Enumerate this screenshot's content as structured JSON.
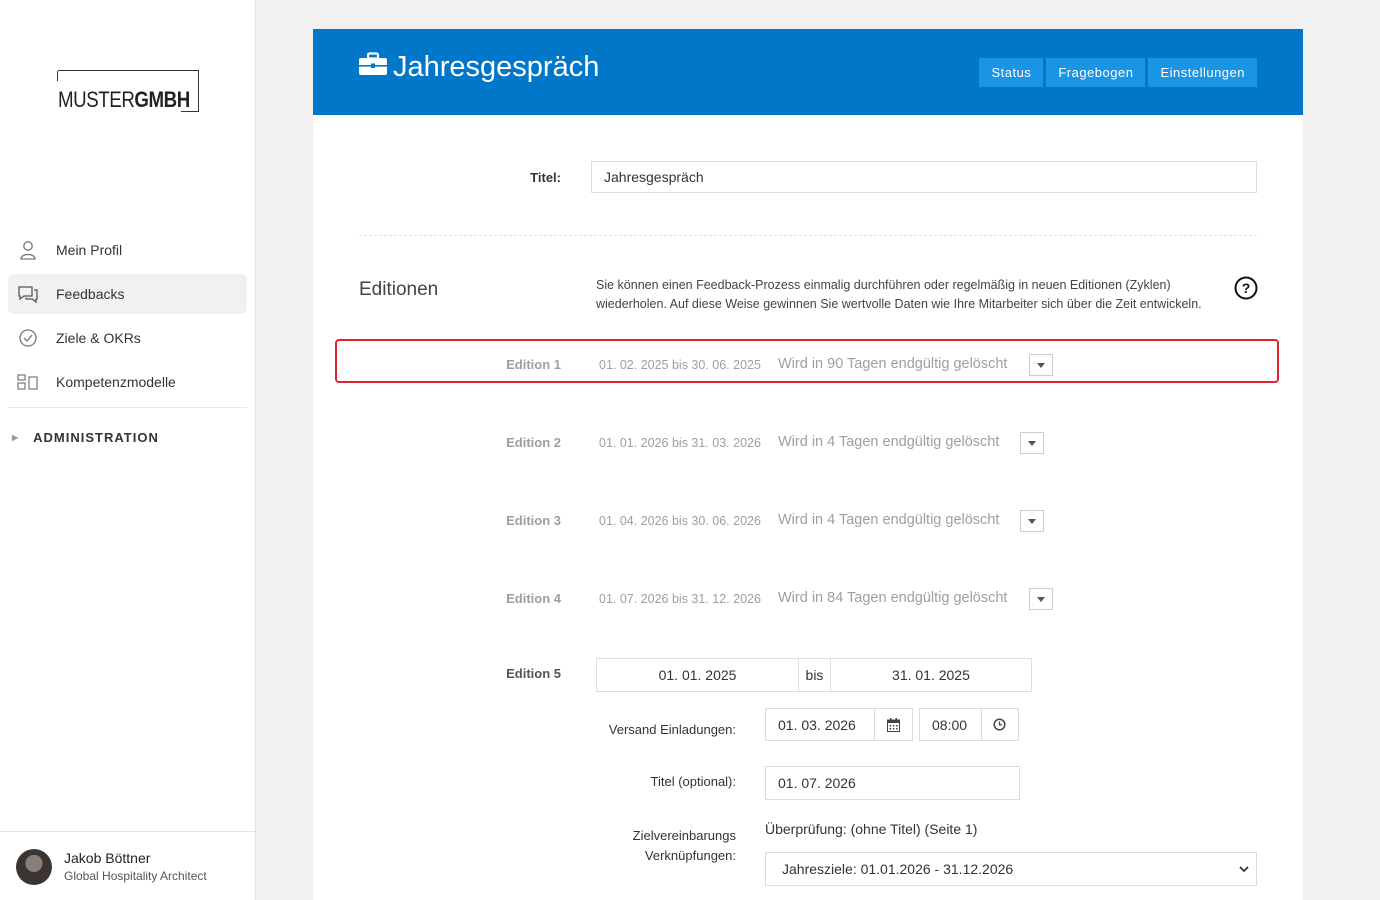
{
  "sidebar": {
    "logo": {
      "light": "MUSTER",
      "bold": "GMBH"
    },
    "items": [
      {
        "label": "Mein Profil",
        "icon": "user-icon"
      },
      {
        "label": "Feedbacks",
        "icon": "chat-icon",
        "active": true
      },
      {
        "label": "Ziele & OKRs",
        "icon": "check-circle-icon"
      },
      {
        "label": "Kompetenzmodelle",
        "icon": "modules-icon"
      }
    ],
    "admin_label": "ADMINISTRATION",
    "user": {
      "name": "Jakob Böttner",
      "role": "Global Hospitality Architect"
    }
  },
  "header": {
    "title": "Jahresgespräch",
    "buttons": [
      "Status",
      "Fragebogen",
      "Einstellungen"
    ],
    "colors": {
      "header_bg": "#0077c8",
      "button_bg": "#1a95e6"
    }
  },
  "form": {
    "title_label": "Titel:",
    "title_value": "Jahresgespräch",
    "section_title": "Editionen",
    "section_desc": "Sie können einen Feedback-Prozess einmalig durchführen oder regelmäßig in neuen Editionen (Zyklen) wiederholen. Auf diese Weise gewinnen Sie wertvolle Daten wie Ihre Mitarbeiter sich über die Zeit entwickeln."
  },
  "editions": [
    {
      "label": "Edition 1",
      "dates": "01. 02. 2025 bis 30. 06. 2025",
      "status": "Wird in 90 Tagen endgültig gelöscht",
      "highlighted": true
    },
    {
      "label": "Edition 2",
      "dates": "01. 01. 2026 bis 31. 03. 2026",
      "status": "Wird in 4 Tagen endgültig gelöscht"
    },
    {
      "label": "Edition 3",
      "dates": "01. 04. 2026 bis 30. 06. 2026",
      "status": "Wird in 4 Tagen endgültig gelöscht"
    },
    {
      "label": "Edition 4",
      "dates": "01. 07. 2026 bis 31. 12. 2026",
      "status": "Wird in 84 Tagen endgültig gelöscht"
    }
  ],
  "edition5": {
    "label": "Edition 5",
    "from": "01. 01. 2025",
    "bis": "bis",
    "to": "31. 01. 2025",
    "versand_label": "Versand Einladungen:",
    "versand_date": "01. 03. 2026",
    "versand_time": "08:00",
    "titel_label": "Titel (optional):",
    "titel_value": "01. 07. 2026",
    "ziel_label_1": "Zielvereinbarungs",
    "ziel_label_2": "Verknüpfungen:",
    "ziel_text": "Überprüfung: (ohne Titel) (Seite 1)",
    "ziel_select": "Jahresziele: 01.01.2026 - 31.12.2026"
  }
}
